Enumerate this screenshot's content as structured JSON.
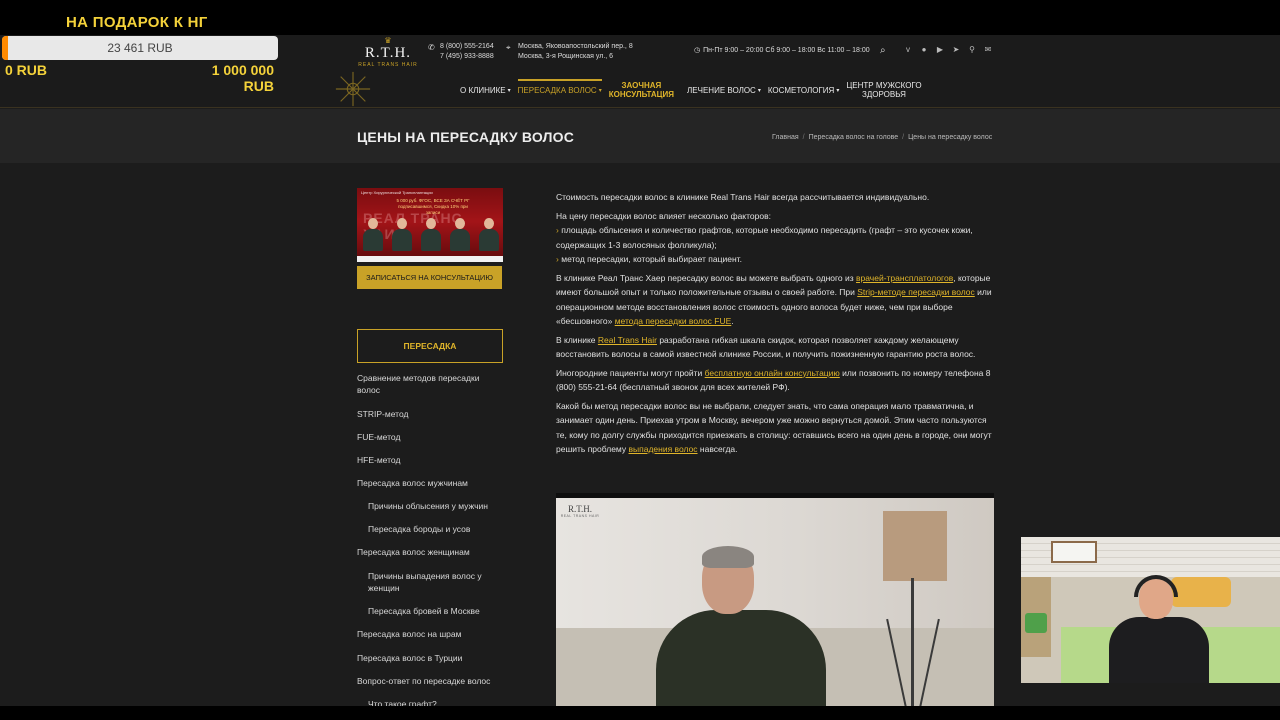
{
  "stream": {
    "donation_title": "НА ПОДАРОК К НГ",
    "donation_amount": "23 461 RUB",
    "donation_progress_fraction": 0.02346,
    "donation_min": "0 RUB",
    "donation_max": "1 000 000 RUB",
    "accent_color": "#f4d23a",
    "fill_color": "#ff8a00"
  },
  "header": {
    "logo_brand": "R.T.H.",
    "logo_sub": "REAL TRANS HAIR",
    "phone_1": "8 (800) 555-2164",
    "phone_2": "7 (495) 933-8888",
    "address_1": "Москва, Яковоапостольский пер., 8",
    "address_2": "Москва, 3-я Рощинская ул., 6",
    "hours": "Пн-Пт 9:00 – 20:00 Сб 9:00 – 18:00 Вс 11:00 – 18:00",
    "icons": {
      "phone": "phone-icon",
      "address": "location-pin-icon",
      "hours": "clock-icon",
      "search": "search-icon",
      "socials": [
        "vk-icon",
        "ok-icon",
        "youtube-icon",
        "telegram-icon",
        "odnoklassniki-icon",
        "mail-icon"
      ]
    },
    "nav": [
      {
        "label": "О КЛИНИКЕ",
        "dropdown": true
      },
      {
        "label": "ПЕРЕСАДКА ВОЛОС",
        "dropdown": true,
        "active": true
      },
      {
        "label": "ЗАОЧНАЯ КОНСУЛЬТАЦИЯ",
        "line1": "ЗАОЧНАЯ",
        "line2": "КОНСУЛЬТАЦИЯ"
      },
      {
        "label": "ЛЕЧЕНИЕ ВОЛОС",
        "dropdown": true
      },
      {
        "label": "КОСМЕТОЛОГИЯ",
        "dropdown": true
      },
      {
        "label": "ЦЕНТР МУЖСКОГО ЗДОРОВЬЯ",
        "line1": "ЦЕНТР МУЖСКОГО",
        "line2": "ЗДОРОВЬЯ"
      }
    ]
  },
  "title_bar": {
    "title": "ЦЕНЫ НА ПЕРЕСАДКУ ВОЛОС",
    "breadcrumb": [
      "Главная",
      "Пересадка волос на голове",
      "Цены на пересадку волос"
    ],
    "separator": "/"
  },
  "sidebar": {
    "banner_header": "Центр Хирургической Трансплантации",
    "banner_promo": "5 000 руб. ФГОС, ВСЕ ЗА СЧЁТ РГ подписавшимся, Скидка 10% при записи",
    "banner_bg_word": "РЕАЛ ТРАНС ХАИР",
    "consult_button": "ЗАПИСАТЬСЯ НА КОНСУЛЬТАЦИЮ",
    "section_title": "ПЕРЕСАДКА",
    "menu": [
      {
        "label": "Сравнение методов пересадки волос",
        "sub": false
      },
      {
        "label": "STRIP-метод",
        "sub": false
      },
      {
        "label": "FUE-метод",
        "sub": false
      },
      {
        "label": "HFE-метод",
        "sub": false
      },
      {
        "label": "Пересадка волос мужчинам",
        "sub": false
      },
      {
        "label": "Причины облысения у мужчин",
        "sub": true
      },
      {
        "label": "Пересадка бороды и усов",
        "sub": true
      },
      {
        "label": "Пересадка волос женщинам",
        "sub": false
      },
      {
        "label": "Причины выпадения волос у женщин",
        "sub": true
      },
      {
        "label": "Пересадка бровей в Москве",
        "sub": true
      },
      {
        "label": "Пересадка волос на шрам",
        "sub": false
      },
      {
        "label": "Пересадка волос в Турции",
        "sub": false
      },
      {
        "label": "Вопрос-ответ по пересадке волос",
        "sub": false
      },
      {
        "label": "Что такое графт?",
        "sub": true
      }
    ]
  },
  "content": {
    "p1": "Стоимость пересадки волос в клинике Real Trans Hair всегда рассчитывается индивидуально.",
    "p2": "На цену пересадки волос влияет несколько факторов:",
    "bullet_1": "площадь облысения и количество графтов, которые необходимо пересадить (графт – это кусочек кожи, содержащих 1-3 волосяных фолликула);",
    "bullet_2": "метод пересадки, который выбирает пациент.",
    "p3_a": "В клинике Реал Транс Хаер пересадку волос вы можете выбрать одного из ",
    "p3_link1": "врачей-трансплатологов",
    "p3_b": ", которые имеют большой опыт и только положительные отзывы о своей работе. При ",
    "p3_link2": "Strip-методе пересадки волос",
    "p3_c": " или операционном методе восстановления волос стоимость одного волоса будет ниже, чем при выборе «бесшовного» ",
    "p3_link3": "метода пересадки волос FUE",
    "p3_d": ".",
    "p4_a": "В клинике ",
    "p4_link": "Real Trans Hair",
    "p4_b": " разработана гибкая шкала скидок, которая позволяет каждому желающему восстановить волосы в самой известной клинике России, и получить пожизненную гарантию роста волос.",
    "p5_a": "Иногородние пациенты могут пройти ",
    "p5_link": "бесплатную онлайн консультацию",
    "p5_b": " или позвонить по номеру телефона  8 (800) 555-21-64 (бесплатный звонок для всех жителей РФ).",
    "p6_a": "Какой бы метод пересадки волос вы не выбрали, следует знать, что сама операция мало травматична, и занимает один день. Приехав утром в Москву, вечером уже можно вернуться домой. Этим часто пользуются те, кому по долгу службы приходится приезжать в столицу: оставшись всего на один день в городе, они могут решить проблему ",
    "p6_link": "выпадения волос",
    "p6_b": " навсегда.",
    "video_logo": "R.T.H.",
    "video_logo_sub": "REAL TRANS HAIR"
  },
  "colors": {
    "gold": "#c9a227",
    "link": "#e0b52a",
    "bg": "#1c1c1c"
  }
}
